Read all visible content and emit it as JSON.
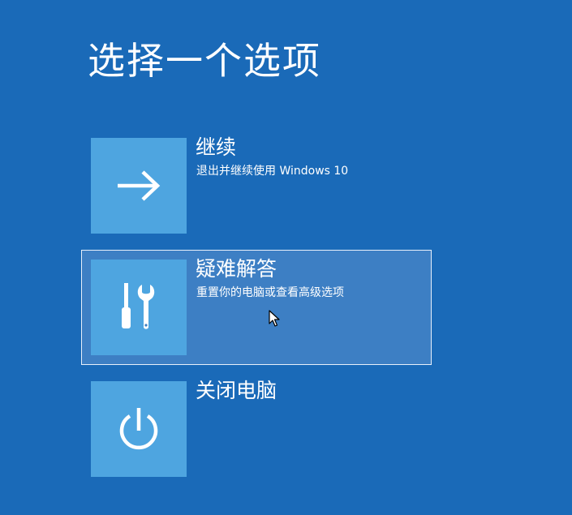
{
  "page": {
    "title": "选择一个选项",
    "background_color": "#1a6ab8",
    "tile_color": "#4ea5e0",
    "selected_color": "#3d7fc4"
  },
  "options": [
    {
      "label": "继续",
      "description": "退出并继续使用 Windows 10",
      "icon": "arrow-right-icon",
      "selected": false
    },
    {
      "label": "疑难解答",
      "description": "重置你的电脑或查看高级选项",
      "icon": "tools-icon",
      "selected": true
    },
    {
      "label": "关闭电脑",
      "description": "",
      "icon": "power-icon",
      "selected": false
    }
  ],
  "cursor": {
    "icon": "mouse-pointer-icon"
  }
}
